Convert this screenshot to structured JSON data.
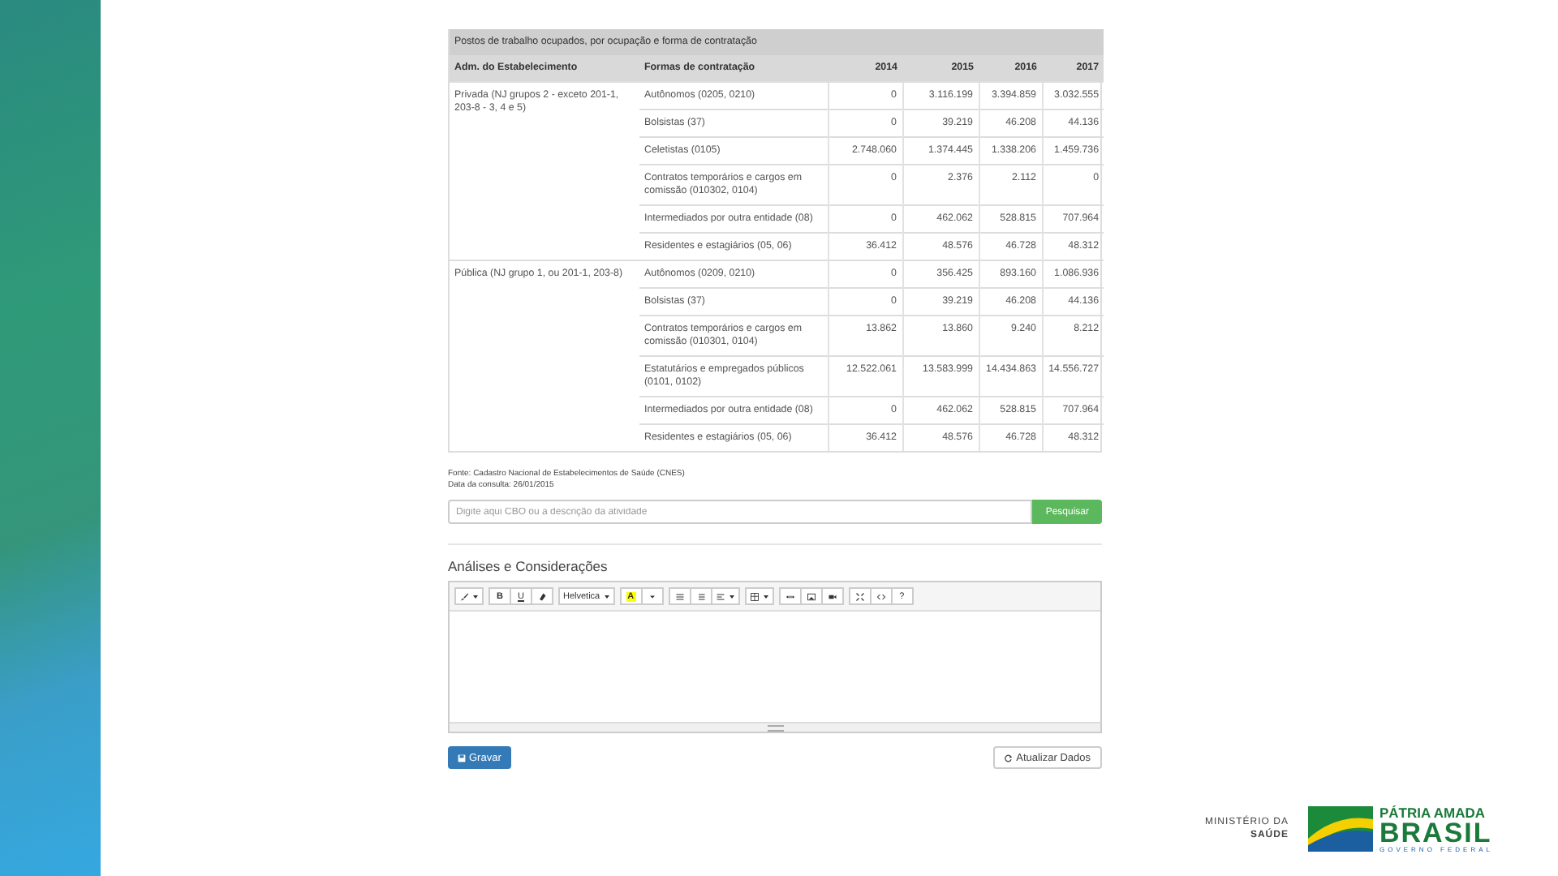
{
  "table": {
    "title": "Postos de trabalho ocupados, por ocupação e forma de contratação",
    "columns": [
      "Adm. do Estabelecimento",
      "Formas de contratação",
      "2014",
      "2015",
      "2016",
      "2017"
    ],
    "groups": [
      {
        "name": "Privada (NJ grupos 2 - exceto 201-1, 203-8 - 3, 4 e 5)",
        "rows": [
          {
            "forma": "Autônomos (0205, 0210)",
            "values": [
              "0",
              "3.116.199",
              "3.394.859",
              "3.032.555"
            ]
          },
          {
            "forma": "Bolsistas (37)",
            "values": [
              "0",
              "39.219",
              "46.208",
              "44.136"
            ]
          },
          {
            "forma": "Celetistas (0105)",
            "values": [
              "2.748.060",
              "1.374.445",
              "1.338.206",
              "1.459.736"
            ]
          },
          {
            "forma": "Contratos temporários e cargos em comissão (010302, 0104)",
            "values": [
              "0",
              "2.376",
              "2.112",
              "0"
            ]
          },
          {
            "forma": "Intermediados por outra entidade (08)",
            "values": [
              "0",
              "462.062",
              "528.815",
              "707.964"
            ]
          },
          {
            "forma": "Residentes e estagiários (05, 06)",
            "values": [
              "36.412",
              "48.576",
              "46.728",
              "48.312"
            ]
          }
        ]
      },
      {
        "name": "Pública (NJ grupo 1, ou 201-1, 203-8)",
        "rows": [
          {
            "forma": "Autônomos (0209, 0210)",
            "values": [
              "0",
              "356.425",
              "893.160",
              "1.086.936"
            ]
          },
          {
            "forma": "Bolsistas (37)",
            "values": [
              "0",
              "39.219",
              "46.208",
              "44.136"
            ]
          },
          {
            "forma": "Contratos temporários e cargos em comissão (010301, 0104)",
            "values": [
              "13.862",
              "13.860",
              "9.240",
              "8.212"
            ]
          },
          {
            "forma": "Estatutários e empregados públicos (0101, 0102)",
            "values": [
              "12.522.061",
              "13.583.999",
              "14.434.863",
              "14.556.727"
            ]
          },
          {
            "forma": "Intermediados por outra entidade (08)",
            "values": [
              "0",
              "462.062",
              "528.815",
              "707.964"
            ]
          },
          {
            "forma": "Residentes e estagiários (05, 06)",
            "values": [
              "36.412",
              "48.576",
              "46.728",
              "48.312"
            ]
          }
        ]
      }
    ]
  },
  "source": "Fonte: Cadastro Nacional de Estabelecimentos de Saúde (CNES)",
  "consult_date": "Data da consulta: 26/01/2015",
  "search": {
    "placeholder": "Digite aqui CBO ou a descrição da atividade",
    "button": "Pesquisar"
  },
  "section_title": "Análises e Considerações",
  "toolbar": [
    [
      {
        "kind": "brush"
      }
    ],
    [
      {
        "kind": "bold",
        "label": "B"
      },
      {
        "kind": "underline",
        "label": "U"
      },
      {
        "kind": "eraser"
      }
    ],
    [
      {
        "kind": "font",
        "label": "Helvetica"
      }
    ],
    [
      {
        "kind": "color",
        "label": "A"
      },
      {
        "kind": "caret"
      }
    ],
    [
      {
        "kind": "ul"
      },
      {
        "kind": "ol"
      },
      {
        "kind": "align"
      }
    ],
    [
      {
        "kind": "table"
      }
    ],
    [
      {
        "kind": "link"
      },
      {
        "kind": "picture"
      },
      {
        "kind": "video"
      }
    ],
    [
      {
        "kind": "fullscreen"
      },
      {
        "kind": "code"
      },
      {
        "kind": "text",
        "label": "?"
      }
    ]
  ],
  "save_button": "Gravar",
  "refresh_button": "Atualizar Dados",
  "logos": {
    "ministry": [
      "MINISTÉRIO DA",
      "SAÚDE"
    ],
    "slogan": "PÁTRIA AMADA",
    "country": "BRASIL",
    "government": "GOVERNO FEDERAL"
  }
}
